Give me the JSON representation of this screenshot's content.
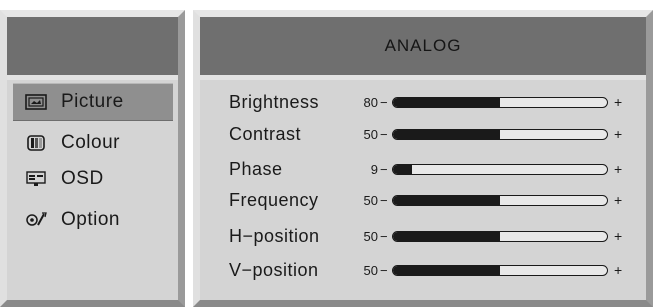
{
  "menu": {
    "items": [
      {
        "label": "Picture",
        "icon": "picture-icon",
        "selected": true
      },
      {
        "label": "Colour",
        "icon": "colour-icon",
        "selected": false
      },
      {
        "label": "OSD",
        "icon": "osd-icon",
        "selected": false
      },
      {
        "label": "Option",
        "icon": "option-icon",
        "selected": false
      }
    ]
  },
  "panel": {
    "title": "ANALOG",
    "settings": [
      {
        "label": "Brightness",
        "value": "80",
        "minus": "−",
        "plus": "+",
        "fill_fraction": 0.5
      },
      {
        "label": "Contrast",
        "value": "50",
        "minus": "−",
        "plus": "+",
        "fill_fraction": 0.5
      },
      {
        "label": "Phase",
        "value": "9",
        "minus": "−",
        "plus": "+",
        "fill_fraction": 0.09
      },
      {
        "label": "Frequency",
        "value": "50",
        "minus": "−",
        "plus": "+",
        "fill_fraction": 0.5
      },
      {
        "label": "H−position",
        "value": "50",
        "minus": "−",
        "plus": "+",
        "fill_fraction": 0.5
      },
      {
        "label": "V−position",
        "value": "50",
        "minus": "−",
        "plus": "+",
        "fill_fraction": 0.5
      }
    ]
  },
  "colors": {
    "header_bg": "#6f6f6f",
    "panel_bg": "#d4d4d4",
    "selected_bg": "#8f8f8f",
    "slider_fill": "#1a1a1a"
  }
}
